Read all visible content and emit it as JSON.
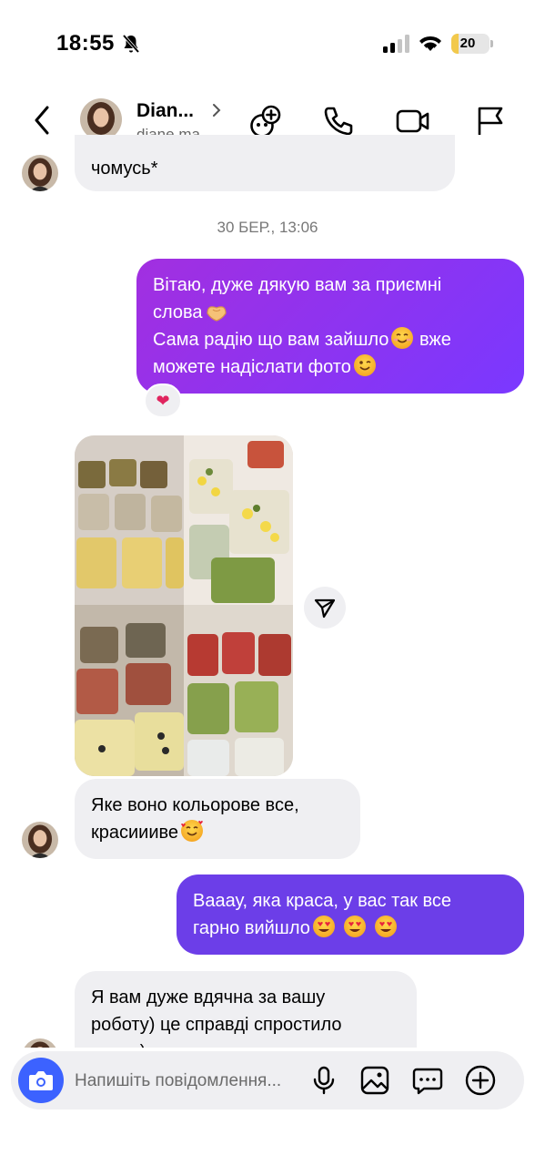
{
  "status_bar": {
    "time": "18:55",
    "battery": "20",
    "battery_level": 0.2
  },
  "header": {
    "name": "Dian...",
    "handle": "diane.ma..."
  },
  "icons": {
    "back": "back-chevron-icon",
    "add_people": "add-people-icon",
    "phone": "phone-icon",
    "video": "video-camera-icon",
    "flag": "flag-icon",
    "share": "share-icon",
    "camera": "camera-icon",
    "mic": "microphone-icon",
    "gallery": "gallery-icon",
    "sticker": "sticker-icon",
    "add": "plus-icon"
  },
  "colors": {
    "outgoing_start": "#7a38ff",
    "outgoing_mid": "#a22fe0",
    "outgoing_late": "#6c3ee8",
    "incoming": "#efeff2",
    "accent": "#3c62ff"
  },
  "chat": {
    "top_message": "чомусь*",
    "date_separator": "30 БЕР., 13:06",
    "outgoing_1": {
      "line1": "Вітаю, дуже дякую вам за приємні",
      "line2": "слова",
      "line3": "Сама радію що вам зайшло",
      "line3b": "вже",
      "line4": "можете надіслати фото"
    },
    "reaction": "❤",
    "incoming_1": {
      "line1": "Яке воно кольорове все,",
      "line2": "красиииве"
    },
    "outgoing_2": {
      "line1": "Вааау, яка краса, у вас так все",
      "line2": "гарно вийшло"
    },
    "incoming_2": {
      "line1": "Я вам дуже вдячна за вашу",
      "line2": "роботу) це справді спростило",
      "line3": "життя)"
    }
  },
  "composer": {
    "placeholder": "Напишіть повідомлення..."
  }
}
